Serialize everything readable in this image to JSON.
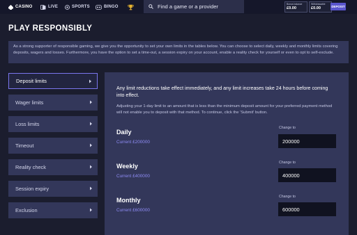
{
  "nav": {
    "items": [
      {
        "label": "CASINO",
        "icon": "casino-icon"
      },
      {
        "label": "LIVE",
        "icon": "live-icon"
      },
      {
        "label": "SPORTS",
        "icon": "sports-icon"
      },
      {
        "label": "BINGO",
        "icon": "bingo-icon"
      },
      {
        "label": "",
        "icon": "trophy-icon"
      }
    ],
    "search_placeholder": "Find a game or a provider",
    "bonus_balance": {
      "label": "Bonus balance",
      "value": "£0.00"
    },
    "withdrawable": {
      "label": "Withdrawable",
      "value": "£0.00"
    },
    "deposit_label": "DEPOSIT"
  },
  "page": {
    "title": "PLAY RESPONSIBLY",
    "intro": "As a strong supporter of responsible gaming, we give you the opportunity to set your own limits in the tables below. You can choose to select daily, weekly and monthly limits covering deposits, wagers and losses. Furthermore, you have the option to set a time-out, a session expiry on your account, enable a reality check for yourself or even to opt to self-exclude."
  },
  "sidebar": {
    "items": [
      {
        "label": "Deposit limits"
      },
      {
        "label": "Wager limits"
      },
      {
        "label": "Loss limits"
      },
      {
        "label": "Timeout"
      },
      {
        "label": "Reality check"
      },
      {
        "label": "Session expiry"
      },
      {
        "label": "Exclusion"
      }
    ]
  },
  "panel": {
    "notice": "Any limit reductions take effect immediately, and any limit increases take 24 hours before coming into effect.",
    "subnote": "Adjusting your 1-day limit to an amount that is less than the minimum deposit amount for your preferred payment method will not enable you to deposit with that method. To continue, click the 'Submit' button.",
    "limits": [
      {
        "name": "Daily",
        "current": "Current £200000",
        "change_label": "Change to",
        "value": "200000"
      },
      {
        "name": "Weekly",
        "current": "Current £400000",
        "change_label": "Change to",
        "value": "400000"
      },
      {
        "name": "Monthly",
        "current": "Current £600000",
        "change_label": "Change to",
        "value": "600000"
      }
    ]
  },
  "colors": {
    "background": "#1b1d2e",
    "panel": "#33375a",
    "accent": "#7a76ee",
    "current_text": "#8f8cf6",
    "deposit_button": "#5a56ce"
  }
}
